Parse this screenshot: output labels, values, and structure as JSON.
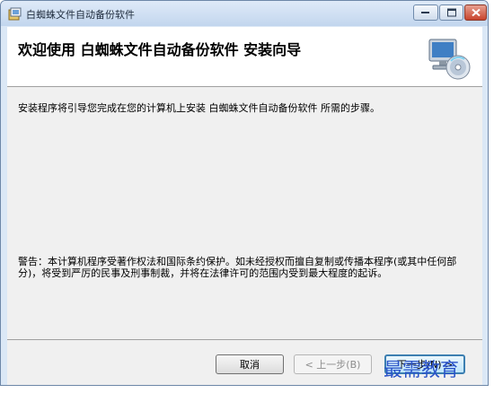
{
  "window": {
    "title": "白蜘蛛文件自动备份软件"
  },
  "header": {
    "title": "欢迎使用 白蜘蛛文件自动备份软件 安装向导"
  },
  "body": {
    "intro": "安装程序将引导您完成在您的计算机上安装 白蜘蛛文件自动备份软件 所需的步骤。",
    "warning": "警告：本计算机程序受著作权法和国际条约保护。如未经授权而擅自复制或传播本程序(或其中任何部分)，将受到严厉的民事及刑事制裁，并将在法律许可的范围内受到最大程度的起诉。"
  },
  "buttons": {
    "cancel": "取消",
    "back": "< 上一步(B)",
    "next": "下一步(N) >"
  },
  "watermark": "最需教育",
  "colors": {
    "accent": "#3c7fb1",
    "close": "#c8442d",
    "title_bar": "#c2d6ee"
  },
  "icons": [
    "installer-app-icon",
    "minimize-icon",
    "maximize-icon",
    "close-icon",
    "computer-disc-icon"
  ]
}
